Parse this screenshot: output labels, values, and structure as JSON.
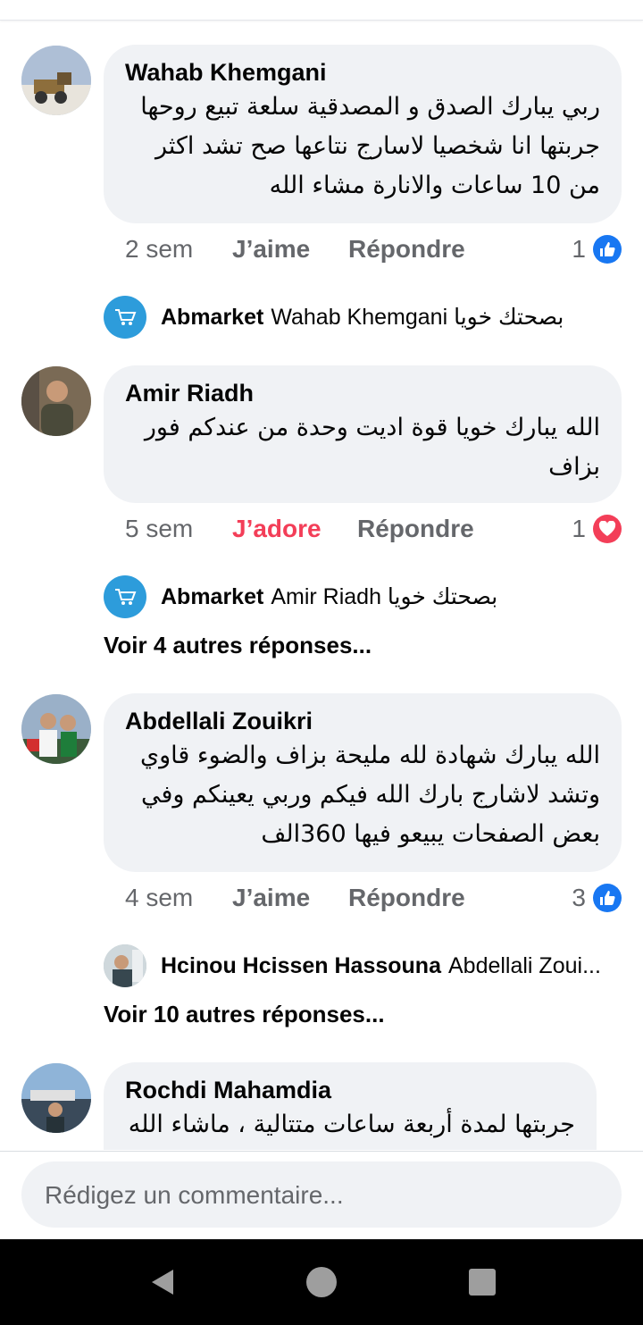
{
  "comments": [
    {
      "author": "Wahab Khemgani",
      "lines": [
        "ربي يبارك الصدق و المصدقية سلعة تبيع روحها",
        "جربتها انا شخصيا لاسارج نتاعها صح تشد اكثر",
        "من 10 ساعات والانارة مشاء الله"
      ],
      "time": "2 sem",
      "reaction_label": "J’aime",
      "reply_label": "Répondre",
      "reaction_count": "1",
      "reaction_icon": "like-icon",
      "reply": {
        "name": "Abmarket",
        "text": "Wahab Khemgani بصحتك خويا"
      }
    },
    {
      "author": "Amir Riadh",
      "lines": [
        "الله يبارك خويا قوة اديت وحدة من عندكم فور",
        "بزاف"
      ],
      "time": "5 sem",
      "reaction_label": "J’adore",
      "reply_label": "Répondre",
      "reaction_count": "1",
      "reaction_icon": "love-icon",
      "reply": {
        "name": "Abmarket",
        "text": "Amir Riadh بصحتك خويا"
      },
      "more": "Voir 4 autres réponses..."
    },
    {
      "author": "Abdellali Zouikri",
      "lines": [
        "الله يبارك شهادة لله مليحة بزاف والضوء قاوي",
        "وتشد لاشارج بارك الله فيكم وربي يعينكم وفي",
        "بعض الصفحات يبيعو فيها 360الف"
      ],
      "time": "4 sem",
      "reaction_label": "J’aime",
      "reply_label": "Répondre",
      "reaction_count": "3",
      "reaction_icon": "like-icon",
      "reply": {
        "name": "Hcinou Hcissen Hassouna",
        "text": "Abdellali Zoui..."
      },
      "more": "Voir 10 autres réponses..."
    },
    {
      "author": "Rochdi Mahamdia",
      "lines": [
        "جربتها لمدة أربعة ساعات متتالية ، ماشاء الله"
      ]
    }
  ],
  "composer": {
    "placeholder": "Rédigez un commentaire..."
  },
  "colors": {
    "like": "#1877f2",
    "love": "#f33e58",
    "secondary_text": "#65676b",
    "bubble": "#f0f2f5",
    "abmarket_brand": "#2d9cdb"
  },
  "navbar": {
    "back": "back-icon",
    "home": "home-icon",
    "recents": "recents-icon"
  }
}
